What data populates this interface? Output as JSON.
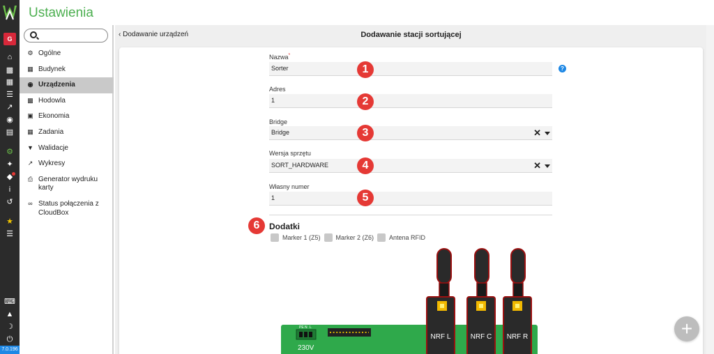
{
  "app": {
    "title": "Ustawienia",
    "user_initial": "G",
    "version": "7.0.196"
  },
  "rail": {
    "icons": [
      "home-icon",
      "cow-icon",
      "calendar-icon",
      "list-icon",
      "chart-icon",
      "money-bag-icon",
      "document-icon",
      "gear-icon",
      "wrench-icon",
      "bell-icon",
      "info-icon",
      "history-icon",
      "star-icon",
      "menu-list-icon",
      "keyboard-icon",
      "user-upload-icon",
      "moon-icon",
      "power-icon"
    ]
  },
  "sidebar": {
    "items": [
      {
        "label": "Ogólne",
        "icon": "cogs-icon"
      },
      {
        "label": "Budynek",
        "icon": "building-icon"
      },
      {
        "label": "Urządzenia",
        "icon": "device-icon",
        "active": true
      },
      {
        "label": "Hodowla",
        "icon": "cow-icon"
      },
      {
        "label": "Ekonomia",
        "icon": "money-icon"
      },
      {
        "label": "Zadania",
        "icon": "calendar-icon"
      },
      {
        "label": "Walidacje",
        "icon": "shield-check-icon"
      },
      {
        "label": "Wykresy",
        "icon": "chart-icon"
      },
      {
        "label": "Generator wydruku karty",
        "icon": "printer-icon"
      },
      {
        "label": "Status połączenia z CloudBox",
        "icon": "link-icon"
      }
    ]
  },
  "header": {
    "back_label": "Dodawanie urządzeń",
    "title": "Dodawanie stacji sortującej"
  },
  "form": {
    "name_label": "Nazwa",
    "name_required_mark": "*",
    "name_value": "Sorter",
    "help_label": "?",
    "address_label": "Adres",
    "address_value": "1",
    "bridge_label": "Bridge",
    "bridge_value": "Bridge",
    "hardware_label": "Wersja sprzętu",
    "hardware_value": "SORT_HARDWARE",
    "own_number_label": "Własny numer",
    "own_number_value": "1",
    "clear_symbol": "✕"
  },
  "addons": {
    "title": "Dodatki",
    "options": [
      "Marker 1 (Z5)",
      "Marker 2 (Z6)",
      "Antena RFID"
    ]
  },
  "markers": [
    "1",
    "2",
    "3",
    "4",
    "5",
    "6"
  ],
  "device": {
    "power_label": "230V",
    "terminal_pins": [
      "PE",
      "N",
      "L"
    ],
    "antennas": [
      "NRF L",
      "NRF C",
      "NRF R"
    ]
  },
  "fab": {
    "label": "+"
  },
  "colors": {
    "accent_green": "#4caf50",
    "marker_red": "#e53935",
    "help_blue": "#1e88e5",
    "pcb_green": "#2fa94b",
    "antenna_dark": "#2a2a2a",
    "antenna_outline": "#9b1010",
    "connector_yellow": "#f2b900"
  }
}
